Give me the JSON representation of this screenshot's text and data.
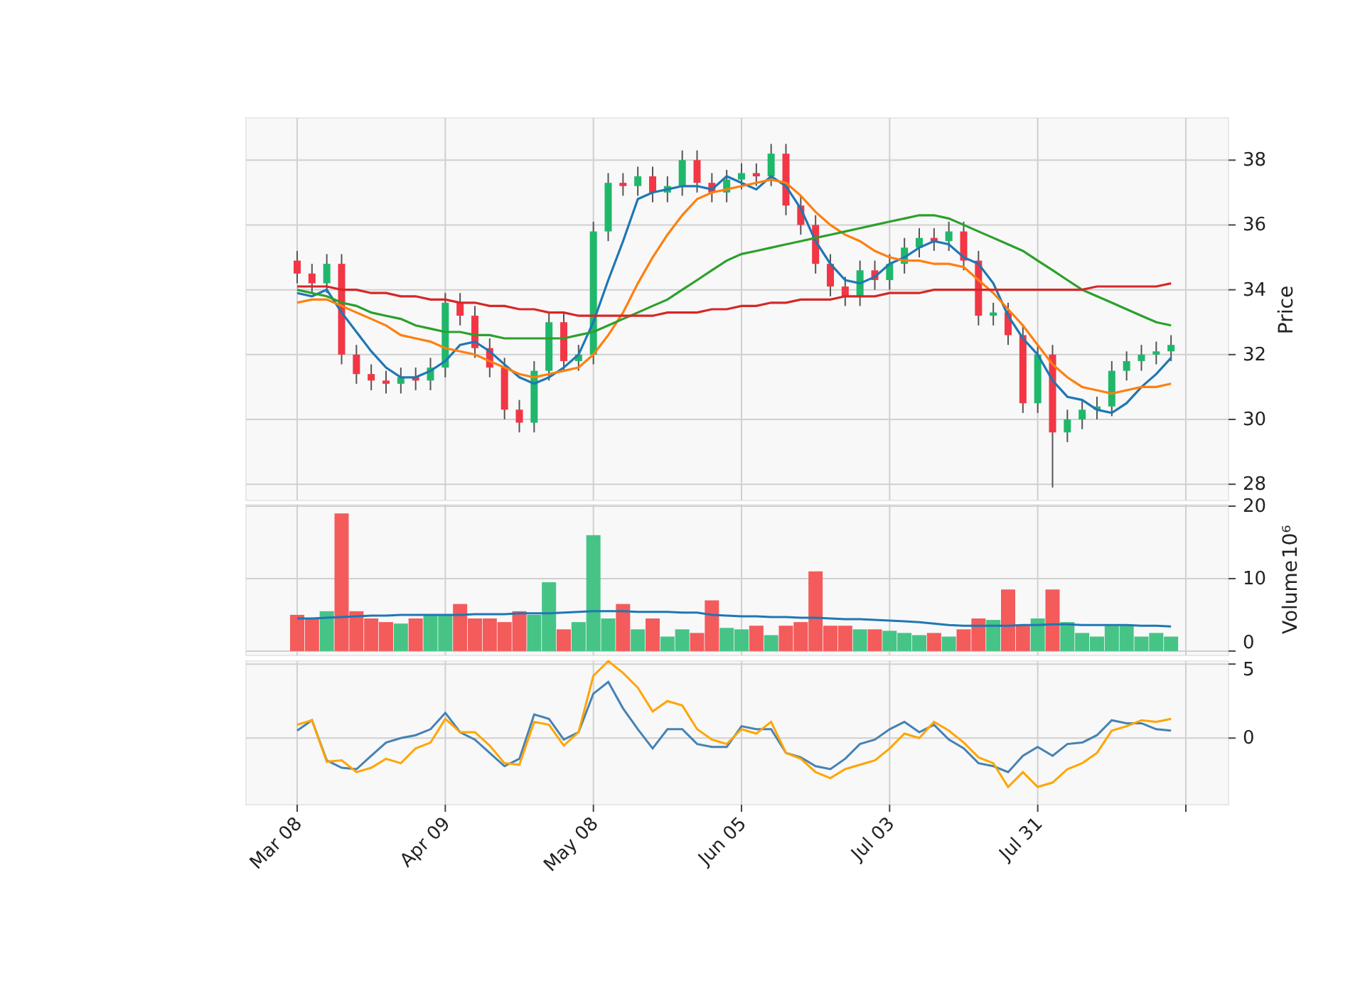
{
  "figure": {
    "price_panel": {
      "chart_data": {
        "type": "candlestick",
        "ylabel": "Price",
        "grid": true,
        "ylim": [
          27.5,
          39.3
        ],
        "yticks": [
          28,
          30,
          32,
          34,
          36,
          38
        ],
        "categories": [
          null,
          null,
          null,
          null,
          null,
          null,
          null,
          null,
          null,
          null,
          null,
          null,
          null,
          null,
          null,
          null,
          null,
          null,
          null,
          null,
          null,
          null,
          null,
          null,
          null,
          null,
          null,
          null,
          null,
          null,
          null,
          null,
          null,
          null,
          null,
          null,
          null,
          null,
          null,
          null,
          null,
          null,
          null,
          null,
          null,
          null,
          null,
          null,
          null,
          null,
          null,
          null,
          null,
          null,
          null,
          null,
          null,
          null,
          null,
          null
        ],
        "ohlc": [
          [
            34.9,
            35.2,
            34.2,
            34.5
          ],
          [
            34.5,
            34.8,
            33.9,
            34.2
          ],
          [
            34.2,
            35.1,
            33.9,
            34.8
          ],
          [
            34.8,
            35.1,
            31.7,
            32.0
          ],
          [
            32.0,
            32.3,
            31.1,
            31.4
          ],
          [
            31.4,
            31.7,
            30.9,
            31.2
          ],
          [
            31.2,
            31.5,
            30.8,
            31.1
          ],
          [
            31.1,
            31.6,
            30.8,
            31.3
          ],
          [
            31.3,
            31.6,
            30.9,
            31.2
          ],
          [
            31.2,
            31.9,
            30.9,
            31.6
          ],
          [
            31.6,
            33.9,
            31.3,
            33.6
          ],
          [
            33.6,
            33.9,
            32.9,
            33.2
          ],
          [
            33.2,
            33.5,
            31.9,
            32.2
          ],
          [
            32.2,
            32.5,
            31.3,
            31.6
          ],
          [
            31.6,
            31.9,
            30.0,
            30.3
          ],
          [
            30.3,
            30.6,
            29.6,
            29.9
          ],
          [
            29.9,
            31.8,
            29.6,
            31.5
          ],
          [
            31.5,
            33.3,
            31.2,
            33.0
          ],
          [
            33.0,
            33.3,
            31.5,
            31.8
          ],
          [
            31.8,
            32.3,
            31.5,
            32.0
          ],
          [
            32.0,
            36.1,
            31.7,
            35.8
          ],
          [
            35.8,
            37.6,
            35.5,
            37.3
          ],
          [
            37.3,
            37.6,
            36.9,
            37.2
          ],
          [
            37.2,
            37.8,
            36.9,
            37.5
          ],
          [
            37.5,
            37.8,
            36.7,
            37.0
          ],
          [
            37.0,
            37.5,
            36.7,
            37.2
          ],
          [
            37.2,
            38.3,
            36.9,
            38.0
          ],
          [
            38.0,
            38.3,
            37.0,
            37.3
          ],
          [
            37.3,
            37.6,
            36.7,
            37.0
          ],
          [
            37.0,
            37.7,
            36.7,
            37.4
          ],
          [
            37.4,
            37.9,
            37.1,
            37.6
          ],
          [
            37.6,
            37.9,
            37.2,
            37.5
          ],
          [
            37.5,
            38.5,
            37.2,
            38.2
          ],
          [
            38.2,
            38.5,
            36.3,
            36.6
          ],
          [
            36.6,
            36.9,
            35.7,
            36.0
          ],
          [
            36.0,
            36.3,
            34.5,
            34.8
          ],
          [
            34.8,
            35.1,
            33.8,
            34.1
          ],
          [
            34.1,
            34.4,
            33.5,
            33.8
          ],
          [
            33.8,
            34.9,
            33.5,
            34.6
          ],
          [
            34.6,
            34.9,
            34.0,
            34.3
          ],
          [
            34.3,
            35.1,
            34.0,
            34.8
          ],
          [
            34.8,
            35.6,
            34.5,
            35.3
          ],
          [
            35.3,
            35.9,
            35.0,
            35.6
          ],
          [
            35.6,
            35.9,
            35.2,
            35.5
          ],
          [
            35.5,
            36.1,
            35.2,
            35.8
          ],
          [
            35.8,
            36.1,
            34.6,
            34.9
          ],
          [
            34.9,
            35.2,
            32.9,
            33.2
          ],
          [
            33.2,
            33.6,
            32.9,
            33.3
          ],
          [
            33.3,
            33.6,
            32.3,
            32.6
          ],
          [
            32.6,
            32.9,
            30.2,
            30.5
          ],
          [
            30.5,
            32.3,
            30.2,
            32.0
          ],
          [
            32.0,
            32.3,
            27.9,
            29.6
          ],
          [
            29.6,
            30.3,
            29.3,
            30.0
          ],
          [
            30.0,
            30.6,
            29.7,
            30.3
          ],
          [
            30.3,
            30.7,
            30.0,
            30.4
          ],
          [
            30.4,
            31.8,
            30.1,
            31.5
          ],
          [
            31.5,
            32.1,
            31.2,
            31.8
          ],
          [
            31.8,
            32.3,
            31.5,
            32.0
          ],
          [
            32.0,
            32.4,
            31.7,
            32.1
          ],
          [
            32.1,
            32.6,
            31.8,
            32.3
          ]
        ],
        "series": [
          {
            "type": "line",
            "color": "#1f77b4",
            "values": [
              33.9,
              33.8,
              34.0,
              33.3,
              32.7,
              32.1,
              31.6,
              31.3,
              31.3,
              31.5,
              31.8,
              32.3,
              32.4,
              32.1,
              31.7,
              31.3,
              31.1,
              31.3,
              31.6,
              32.0,
              33.0,
              34.3,
              35.5,
              36.8,
              37.0,
              37.1,
              37.2,
              37.2,
              37.1,
              37.5,
              37.3,
              37.1,
              37.5,
              37.2,
              36.5,
              35.5,
              34.8,
              34.3,
              34.2,
              34.4,
              34.8,
              35.0,
              35.3,
              35.5,
              35.4,
              35.0,
              34.8,
              34.2,
              33.2,
              32.5,
              32.0,
              31.2,
              30.7,
              30.6,
              30.3,
              30.2,
              30.5,
              31.0,
              31.4,
              31.9
            ]
          },
          {
            "type": "line",
            "color": "#ff7f0e",
            "values": [
              33.6,
              33.7,
              33.7,
              33.5,
              33.3,
              33.1,
              32.9,
              32.6,
              32.5,
              32.4,
              32.2,
              32.1,
              32.0,
              31.8,
              31.6,
              31.4,
              31.3,
              31.4,
              31.5,
              31.6,
              32.0,
              32.6,
              33.3,
              34.2,
              35.0,
              35.7,
              36.3,
              36.8,
              37.0,
              37.1,
              37.2,
              37.3,
              37.4,
              37.3,
              36.9,
              36.4,
              36.0,
              35.7,
              35.5,
              35.2,
              35.0,
              34.9,
              34.9,
              34.8,
              34.8,
              34.7,
              34.3,
              33.9,
              33.4,
              32.9,
              32.3,
              31.7,
              31.3,
              31.0,
              30.9,
              30.8,
              30.9,
              31.0,
              31.0,
              31.1
            ]
          },
          {
            "type": "line",
            "color": "#2ca02c",
            "values": [
              34.0,
              33.9,
              33.8,
              33.6,
              33.5,
              33.3,
              33.2,
              33.1,
              32.9,
              32.8,
              32.7,
              32.7,
              32.6,
              32.6,
              32.5,
              32.5,
              32.5,
              32.5,
              32.5,
              32.6,
              32.7,
              32.9,
              33.1,
              33.3,
              33.5,
              33.7,
              34.0,
              34.3,
              34.6,
              34.9,
              35.1,
              35.2,
              35.3,
              35.4,
              35.5,
              35.6,
              35.7,
              35.8,
              35.9,
              36.0,
              36.1,
              36.2,
              36.3,
              36.3,
              36.2,
              36.0,
              35.8,
              35.6,
              35.4,
              35.2,
              34.9,
              34.6,
              34.3,
              34.0,
              33.8,
              33.6,
              33.4,
              33.2,
              33.0,
              32.9
            ]
          },
          {
            "type": "line",
            "color": "#d62728",
            "values": [
              34.1,
              34.1,
              34.1,
              34.0,
              34.0,
              33.9,
              33.9,
              33.8,
              33.8,
              33.7,
              33.7,
              33.6,
              33.6,
              33.5,
              33.5,
              33.4,
              33.4,
              33.3,
              33.3,
              33.2,
              33.2,
              33.2,
              33.2,
              33.2,
              33.2,
              33.3,
              33.3,
              33.3,
              33.4,
              33.4,
              33.5,
              33.5,
              33.6,
              33.6,
              33.7,
              33.7,
              33.7,
              33.8,
              33.8,
              33.8,
              33.9,
              33.9,
              33.9,
              34.0,
              34.0,
              34.0,
              34.0,
              34.0,
              34.0,
              34.0,
              34.0,
              34.0,
              34.0,
              34.0,
              34.1,
              34.1,
              34.1,
              34.1,
              34.1,
              34.2
            ]
          }
        ]
      }
    },
    "volume_panel": {
      "scale_label": "10⁶",
      "chart_data": {
        "type": "bar",
        "stacked": true,
        "ylabel": "Volume",
        "grid": true,
        "ylim": [
          -0.6,
          20.2
        ],
        "yticks": [
          0,
          10,
          20
        ],
        "categories": [
          null,
          null,
          null,
          null,
          null,
          null,
          null,
          null,
          null,
          null,
          null,
          null,
          null,
          null,
          null,
          null,
          null,
          null,
          null,
          null,
          null,
          null,
          null,
          null,
          null,
          null,
          null,
          null,
          null,
          null,
          null,
          null,
          null,
          null,
          null,
          null,
          null,
          null,
          null,
          null,
          null,
          null,
          null,
          null,
          null,
          null,
          null,
          null,
          null,
          null,
          null,
          null,
          null,
          null,
          null,
          null,
          null,
          null,
          null,
          null
        ],
        "series": [
          {
            "color": "#f45b5b",
            "values": [
              5,
              4.5,
              null,
              19,
              5.5,
              4.5,
              4,
              null,
              4.5,
              null,
              null,
              6.5,
              4.5,
              4.5,
              4,
              5.5,
              null,
              null,
              3,
              null,
              null,
              null,
              6.5,
              null,
              4.5,
              null,
              null,
              2.5,
              7,
              null,
              null,
              3.5,
              null,
              3.5,
              4,
              11,
              3.5,
              3.5,
              null,
              3,
              null,
              null,
              null,
              2.5,
              null,
              3,
              4.5,
              null,
              8.5,
              3.5,
              null,
              8.5,
              null,
              null,
              null,
              null,
              null,
              null,
              null,
              null
            ]
          },
          {
            "color": "#45c486",
            "values": [
              null,
              null,
              5.5,
              null,
              null,
              null,
              null,
              3.8,
              null,
              5,
              5,
              null,
              null,
              null,
              null,
              null,
              5,
              9.5,
              null,
              4,
              16,
              4.5,
              null,
              3,
              null,
              2,
              3,
              null,
              null,
              3.2,
              3,
              null,
              2.2,
              null,
              null,
              null,
              null,
              null,
              3,
              null,
              2.8,
              2.5,
              2.2,
              null,
              2,
              null,
              null,
              4.3,
              null,
              null,
              4.5,
              null,
              4,
              2.5,
              2,
              3.5,
              3.5,
              2,
              2.5,
              2
            ]
          },
          {
            "type": "line",
            "color": "#1f77b4",
            "values": [
              4.5,
              4.5,
              4.6,
              4.7,
              4.8,
              4.9,
              4.9,
              5.0,
              5.0,
              5.0,
              5.0,
              5.0,
              5.1,
              5.1,
              5.1,
              5.2,
              5.2,
              5.2,
              5.3,
              5.4,
              5.5,
              5.5,
              5.5,
              5.4,
              5.4,
              5.4,
              5.3,
              5.3,
              5.0,
              4.9,
              4.8,
              4.8,
              4.7,
              4.7,
              4.6,
              4.6,
              4.5,
              4.4,
              4.4,
              4.3,
              4.2,
              4.1,
              4.0,
              3.8,
              3.6,
              3.5,
              3.5,
              3.5,
              3.5,
              3.6,
              3.6,
              3.7,
              3.7,
              3.6,
              3.6,
              3.6,
              3.6,
              3.5,
              3.5,
              3.4
            ]
          }
        ]
      }
    },
    "indicator_panel": {
      "chart_data": {
        "type": "line",
        "grid": true,
        "ylim": [
          -4.5,
          5.2
        ],
        "yticks": [
          0,
          5
        ],
        "categories": [
          "Mar 08",
          null,
          null,
          null,
          null,
          null,
          null,
          null,
          null,
          null,
          "Apr 09",
          null,
          null,
          null,
          null,
          null,
          null,
          null,
          null,
          null,
          "May 08",
          null,
          null,
          null,
          null,
          null,
          null,
          null,
          null,
          null,
          "Jun 05",
          null,
          null,
          null,
          null,
          null,
          null,
          null,
          null,
          null,
          "Jul 03",
          null,
          null,
          null,
          null,
          null,
          null,
          null,
          null,
          null,
          "Jul 31",
          null,
          null,
          null,
          null,
          null,
          null,
          null,
          null,
          null
        ],
        "series": [
          {
            "color": "#4682b4",
            "values": [
              0.5,
              1.2,
              -1.5,
              -2.0,
              -2.1,
              -1.2,
              -0.3,
              0,
              0.2,
              0.6,
              1.7,
              0.4,
              -0.1,
              -1.0,
              -1.9,
              -1.4,
              1.6,
              1.3,
              -0.1,
              0.4,
              3.0,
              3.8,
              2.0,
              0.6,
              -0.7,
              0.6,
              0.6,
              -0.4,
              -0.6,
              -0.6,
              0.8,
              0.6,
              0.6,
              -1.0,
              -1.3,
              -1.9,
              -2.1,
              -1.4,
              -0.4,
              -0.1,
              0.6,
              1.1,
              0.4,
              0.9,
              -0.1,
              -0.7,
              -1.7,
              -1.9,
              -2.3,
              -1.2,
              -0.6,
              -1.2,
              -0.4,
              -0.3,
              0.2,
              1.2,
              1.0,
              1.0,
              0.6,
              0.5
            ]
          },
          {
            "color": "#ffa500",
            "values": [
              0.9,
              1.2,
              -1.6,
              -1.5,
              -2.3,
              -2.0,
              -1.4,
              -1.7,
              -0.7,
              -0.3,
              1.3,
              0.4,
              0.4,
              -0.5,
              -1.7,
              -1.8,
              1.1,
              0.9,
              -0.5,
              0.4,
              4.2,
              5.2,
              4.4,
              3.4,
              1.8,
              2.5,
              2.2,
              0.6,
              -0.1,
              -0.4,
              0.6,
              0.3,
              1.1,
              -1.0,
              -1.4,
              -2.3,
              -2.7,
              -2.1,
              -1.8,
              -1.5,
              -0.7,
              0.3,
              0,
              1.1,
              0.5,
              -0.3,
              -1.3,
              -1.7,
              -3.3,
              -2.3,
              -3.3,
              -3.0,
              -2.1,
              -1.7,
              -1.0,
              0.5,
              0.8,
              1.2,
              1.1,
              1.3
            ]
          }
        ]
      }
    }
  }
}
